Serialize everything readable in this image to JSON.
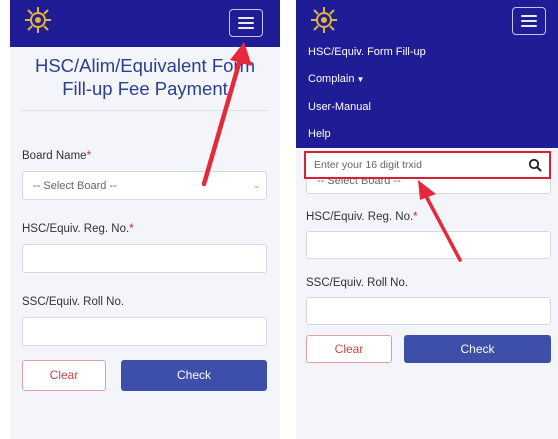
{
  "left_screen": {
    "page_title": "HSC/Alim/Equivalent Form Fill-up Fee Payment",
    "form": {
      "board_label": "Board Name",
      "board_required": "*",
      "board_selected": "-- Select Board --",
      "reg_label": "HSC/Equiv. Reg. No.",
      "reg_required": "*",
      "roll_label": "SSC/Equiv. Roll No.",
      "clear_label": "Clear",
      "check_label": "Check"
    }
  },
  "right_screen": {
    "menu": {
      "items": [
        {
          "label": "HSC/Equiv. Form Fill-up"
        },
        {
          "label": "Complain"
        },
        {
          "label": "User-Manual"
        },
        {
          "label": "Help"
        }
      ]
    },
    "search": {
      "placeholder": "Enter your 16 digit trxid"
    },
    "form": {
      "board_selected": "-- Select Board --",
      "reg_label": "HSC/Equiv. Reg. No.",
      "reg_required": "*",
      "roll_label": "SSC/Equiv. Roll No.",
      "clear_label": "Clear",
      "check_label": "Check"
    }
  },
  "colors": {
    "navbar": "#1f1d95",
    "title": "#2c3f8e",
    "check_button": "#3d4fa8",
    "clear_text": "#c84646",
    "highlight": "#d91e3a",
    "arrow": "#e5293a"
  },
  "icons": [
    "emblem-logo-icon",
    "hamburger-icon",
    "search-icon",
    "chevron-down-icon",
    "caret-down-icon",
    "annotation-arrow"
  ]
}
